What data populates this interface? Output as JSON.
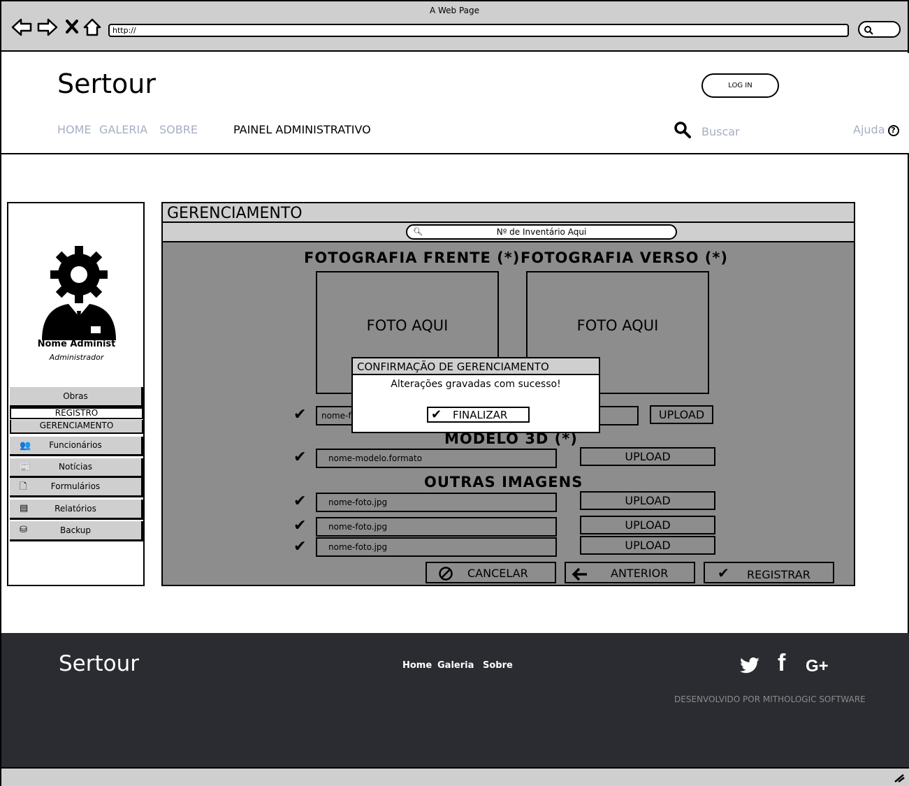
{
  "browser": {
    "title": "A Web Page",
    "url": "http://",
    "back_icon": "back-arrow-icon",
    "forward_icon": "forward-arrow-icon",
    "stop_icon": "close-icon",
    "home_icon": "home-icon"
  },
  "header": {
    "brand": "Sertour",
    "login": "LOG IN",
    "nav": [
      "HOME",
      "GALERIA",
      "SOBRE"
    ],
    "admin_panel": "PAINEL ADMINISTRATIVO",
    "search_placeholder": "Buscar",
    "help": "Ajuda",
    "help_icon_glyph": "?"
  },
  "sidebar": {
    "admin_name": "Nome Administ",
    "admin_role": "Administrador",
    "obras": "Obras",
    "registro": "REGISTRO",
    "gerenciamento": "GERENCIAMENTO",
    "items": [
      {
        "label": "Funcionários",
        "icon": "users-icon"
      },
      {
        "label": "Notícias",
        "icon": "newspaper-icon"
      },
      {
        "label": "Formulários",
        "icon": "document-icon"
      },
      {
        "label": "Relatórios",
        "icon": "report-icon"
      },
      {
        "label": "Backup",
        "icon": "database-icon"
      }
    ]
  },
  "main": {
    "title": "GERENCIAMENTO",
    "inventory_placeholder": "Nº de Inventário Aqui",
    "front_title": "FOTOGRAFIA FRENTE (*)",
    "back_title": "FOTOGRAFIA VERSO (*)",
    "photo_placeholder": "FOTO AQUI",
    "front_file": "nome-f",
    "model_title": "MODELO 3D (*)",
    "model_file": "nome-modelo.formato",
    "other_title": "OUTRAS IMAGENS",
    "other_files": [
      "nome-foto.jpg",
      "nome-foto.jpg",
      "nome-foto.jpg"
    ],
    "upload": "UPLOAD",
    "cancel": "CANCELAR",
    "previous": "ANTERIOR",
    "register": "REGISTRAR"
  },
  "modal": {
    "title": "CONFIRMAÇÃO DE GERENCIAMENTO",
    "message": "Alterações gravadas com sucesso!",
    "button": "FINALIZAR"
  },
  "footer": {
    "brand": "Sertour",
    "links": [
      "Home",
      "Galeria",
      "Sobre"
    ],
    "social": [
      "twitter-icon",
      "facebook-icon",
      "google-plus-icon"
    ],
    "google_plus_text": "G+",
    "facebook_text": "f",
    "credit": "DESENVOLVIDO POR MITHOLOGIC SOFTWARE"
  },
  "colors": {
    "chrome_gray": "#cfcfcf",
    "panel_gray": "#8d8d8d",
    "nav_link": "#a8aec4",
    "footer_bg": "#2b2c31"
  }
}
